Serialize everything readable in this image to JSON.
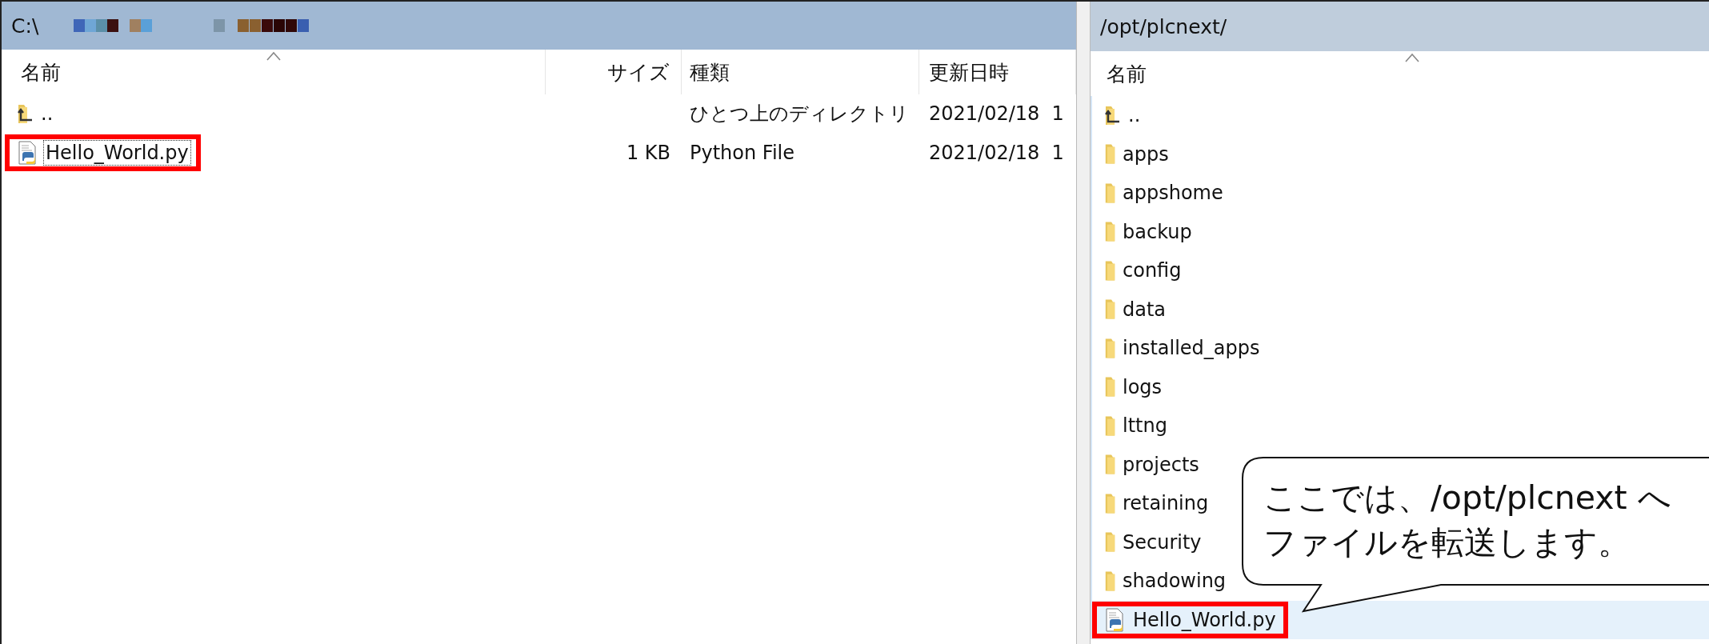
{
  "left_pane": {
    "path": "C:\\",
    "columns": [
      {
        "label": "名前",
        "sorted": true
      },
      {
        "label": "サイズ"
      },
      {
        "label": "種類"
      },
      {
        "label": "更新日時"
      }
    ],
    "rows": [
      {
        "name": "..",
        "kind": "parent",
        "type": "ひとつ上のディレクトリ",
        "modified": "2021/02/18  1",
        "focused": false,
        "highlighted": false
      },
      {
        "name": "Hello_World.py",
        "kind": "python",
        "size": "1 KB",
        "type": "Python File",
        "modified": "2021/02/18  1",
        "focused": true,
        "highlighted": true
      }
    ]
  },
  "right_pane": {
    "path": "/opt/plcnext/",
    "columns": [
      {
        "label": "名前",
        "sorted": true
      }
    ],
    "rows": [
      {
        "name": "..",
        "kind": "parent",
        "selected": false,
        "highlighted": false
      },
      {
        "name": "apps",
        "kind": "folder",
        "selected": false,
        "highlighted": false
      },
      {
        "name": "appshome",
        "kind": "folder",
        "selected": false,
        "highlighted": false
      },
      {
        "name": "backup",
        "kind": "folder",
        "selected": false,
        "highlighted": false
      },
      {
        "name": "config",
        "kind": "folder",
        "selected": false,
        "highlighted": false
      },
      {
        "name": "data",
        "kind": "folder",
        "selected": false,
        "highlighted": false
      },
      {
        "name": "installed_apps",
        "kind": "folder",
        "selected": false,
        "highlighted": false
      },
      {
        "name": "logs",
        "kind": "folder",
        "selected": false,
        "highlighted": false
      },
      {
        "name": "lttng",
        "kind": "folder",
        "selected": false,
        "highlighted": false
      },
      {
        "name": "projects",
        "kind": "folder",
        "selected": false,
        "highlighted": false
      },
      {
        "name": "retaining",
        "kind": "folder",
        "selected": false,
        "highlighted": false
      },
      {
        "name": "Security",
        "kind": "folder",
        "selected": false,
        "highlighted": false
      },
      {
        "name": "shadowing",
        "kind": "folder",
        "selected": false,
        "highlighted": false
      },
      {
        "name": "Hello_World.py",
        "kind": "python",
        "selected": true,
        "highlighted": true
      }
    ]
  },
  "callout": {
    "lines": [
      "ここでは、/opt/plcnext へ",
      "ファイルを転送します。"
    ]
  }
}
